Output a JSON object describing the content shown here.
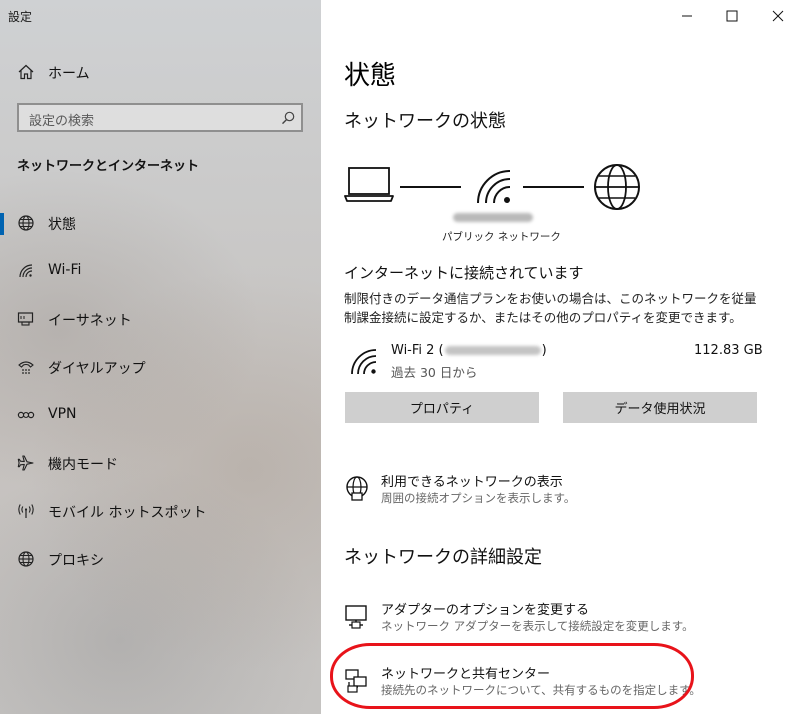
{
  "window": {
    "title": "設定",
    "minimize_icon": "minimize-icon",
    "maximize_icon": "maximize-icon",
    "close_icon": "close-icon"
  },
  "sidebar": {
    "home": {
      "label": "ホーム",
      "icon": "home-icon"
    },
    "search": {
      "placeholder": "設定の検索",
      "icon": "search-icon"
    },
    "section_title": "ネットワークとインターネット",
    "items": [
      {
        "label": "状態",
        "icon": "globe-icon",
        "selected": true
      },
      {
        "label": "Wi-Fi",
        "icon": "wifi-icon"
      },
      {
        "label": "イーサネット",
        "icon": "ethernet-icon"
      },
      {
        "label": "ダイヤルアップ",
        "icon": "dialup-icon"
      },
      {
        "label": "VPN",
        "icon": "vpn-icon"
      },
      {
        "label": "機内モード",
        "icon": "airplane-icon"
      },
      {
        "label": "モバイル ホットスポット",
        "icon": "hotspot-icon"
      },
      {
        "label": "プロキシ",
        "icon": "globe-icon"
      }
    ],
    "accent_color": "#0063b1"
  },
  "main": {
    "page_title": "状態",
    "network_status_heading": "ネットワークの状態",
    "diagram": {
      "icons": [
        "laptop-icon",
        "wifi-signal-icon",
        "internet-globe-icon"
      ],
      "network_type": "パブリック ネットワーク"
    },
    "connection_status": "インターネットに接続されています",
    "connection_description": "制限付きのデータ通信プランをお使いの場合は、このネットワークを従量制課金接続に設定するか、またはその他のプロパティを変更できます。",
    "wifi": {
      "name_prefix": "Wi-Fi 2 (",
      "name_suffix": ")",
      "usage": "112.83 GB",
      "period": "過去 30 日から",
      "icon": "wifi-signal-icon"
    },
    "buttons": {
      "properties": "プロパティ",
      "data_usage": "データ使用状況"
    },
    "available_networks": {
      "title": "利用できるネットワークの表示",
      "subtitle": "周囲の接続オプションを表示します。",
      "icon": "network-globe-icon"
    },
    "advanced_heading": "ネットワークの詳細設定",
    "adapter_options": {
      "title": "アダプターのオプションを変更する",
      "subtitle": "ネットワーク アダプターを表示して接続設定を変更します。",
      "icon": "monitor-network-icon"
    },
    "sharing_center": {
      "title": "ネットワークと共有センター",
      "subtitle": "接続先のネットワークについて、共有するものを指定します。",
      "icon": "sharing-center-icon"
    },
    "highlight_color": "#e8131a"
  }
}
